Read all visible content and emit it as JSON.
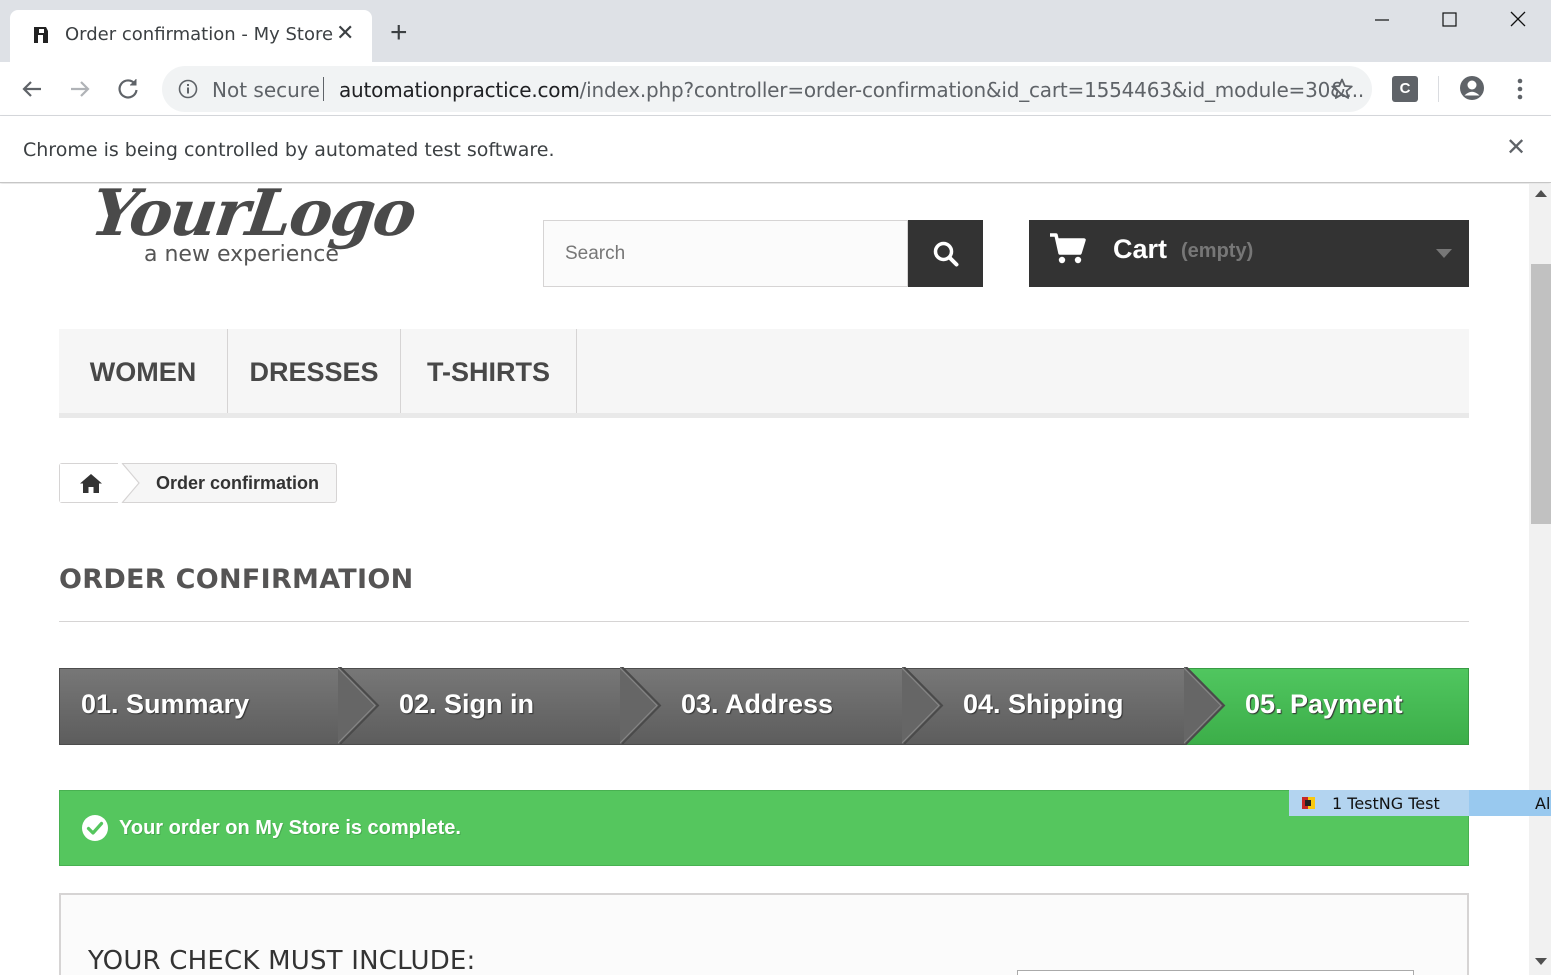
{
  "browser": {
    "tab_title": "Order confirmation - My Store",
    "security_label": "Not secure",
    "url_host": "automationpractice.com",
    "url_path": "/index.php?controller=order-confirmation&id_cart=1554463&id_module=30&...",
    "extension_label": "C",
    "infobar_text": "Chrome is being controlled by automated test software."
  },
  "header": {
    "logo_main": "YourLogo",
    "logo_sub": "a new experience",
    "search_placeholder": "Search",
    "cart_label": "Cart",
    "cart_status": "(empty)"
  },
  "menu": {
    "items": [
      "WOMEN",
      "DRESSES",
      "T-SHIRTS"
    ]
  },
  "breadcrumb": {
    "current": "Order confirmation"
  },
  "page": {
    "heading": "ORDER CONFIRMATION"
  },
  "steps": [
    {
      "label": "01. Summary",
      "active": false
    },
    {
      "label": "02. Sign in",
      "active": false
    },
    {
      "label": "03. Address",
      "active": false
    },
    {
      "label": "04. Shipping",
      "active": false
    },
    {
      "label": "05. Payment",
      "active": true
    }
  ],
  "alert": {
    "text": "Your order on My Store is complete."
  },
  "box": {
    "title": "YOUR CHECK MUST INCLUDE:"
  },
  "testng": {
    "text": "1 TestNG Test",
    "trailing": "Al"
  },
  "colors": {
    "success": "#55c65e",
    "step_active": "#46b851",
    "step_inactive": "#6a6a6a",
    "dark": "#333333"
  }
}
